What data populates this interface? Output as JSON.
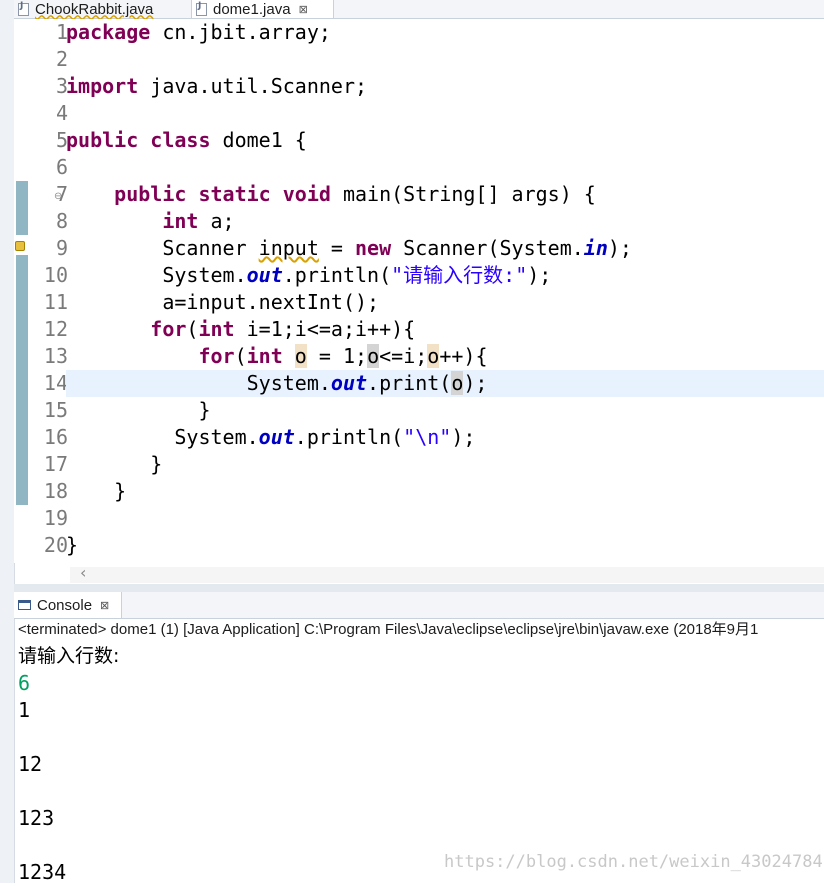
{
  "editor_tabs": [
    {
      "label": "ChookRabbit.java",
      "warning": true
    },
    {
      "label": "dome1.java",
      "close_icon": "close-icon",
      "active": true
    }
  ],
  "code": {
    "line_numbers": [
      "1",
      "2",
      "3",
      "4",
      "5",
      "6",
      "7",
      "8",
      "9",
      "10",
      "11",
      "12",
      "13",
      "14",
      "15",
      "16",
      "17",
      "18",
      "19",
      "20"
    ],
    "current_line": 14
  },
  "console": {
    "tab_label": "Console",
    "status": "<terminated> dome1 (1) [Java Application] C:\\Program Files\\Java\\eclipse\\eclipse\\jre\\bin\\javaw.exe (2018年9月1",
    "output": [
      "请输入行数:",
      "6",
      "1",
      "",
      "12",
      "",
      "123",
      "",
      "1234"
    ]
  },
  "watermark": "https://blog.csdn.net/weixin_43024784",
  "colors": {
    "keyword": "#7f0055",
    "field": "#0000c0",
    "string": "#2a00ff",
    "input_echo": "#00a060",
    "current_line_bg": "#e8f2fe"
  }
}
